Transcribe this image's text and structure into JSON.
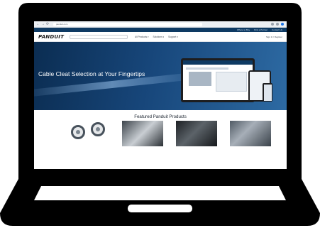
{
  "browser": {
    "nav": [
      "←",
      "→",
      "⟳"
    ],
    "address": "panduit.com"
  },
  "topstrip": {
    "links": [
      "Where to Buy",
      "Find a Partner",
      "Contact Us"
    ]
  },
  "header": {
    "logo": "PANDUIT",
    "search_placeholder": "",
    "menu": [
      "All Products ▾",
      "Solutions ▾",
      "Support ▾"
    ],
    "account": "Sign In / Register"
  },
  "hero": {
    "title": "Cable Cleat Selection at Your Fingertips",
    "subtitle": "",
    "link": ""
  },
  "featured": {
    "title": "Featured Panduit Products",
    "products": [
      {
        "name": "",
        "desc": ""
      },
      {
        "name": "",
        "desc": ""
      },
      {
        "name": "",
        "desc": ""
      },
      {
        "name": "",
        "desc": ""
      }
    ]
  },
  "colors": {
    "laptop": "#000000",
    "hero_dark": "#0b2d52",
    "hero_light": "#2d6aa3",
    "link_blue": "#1463a8"
  }
}
